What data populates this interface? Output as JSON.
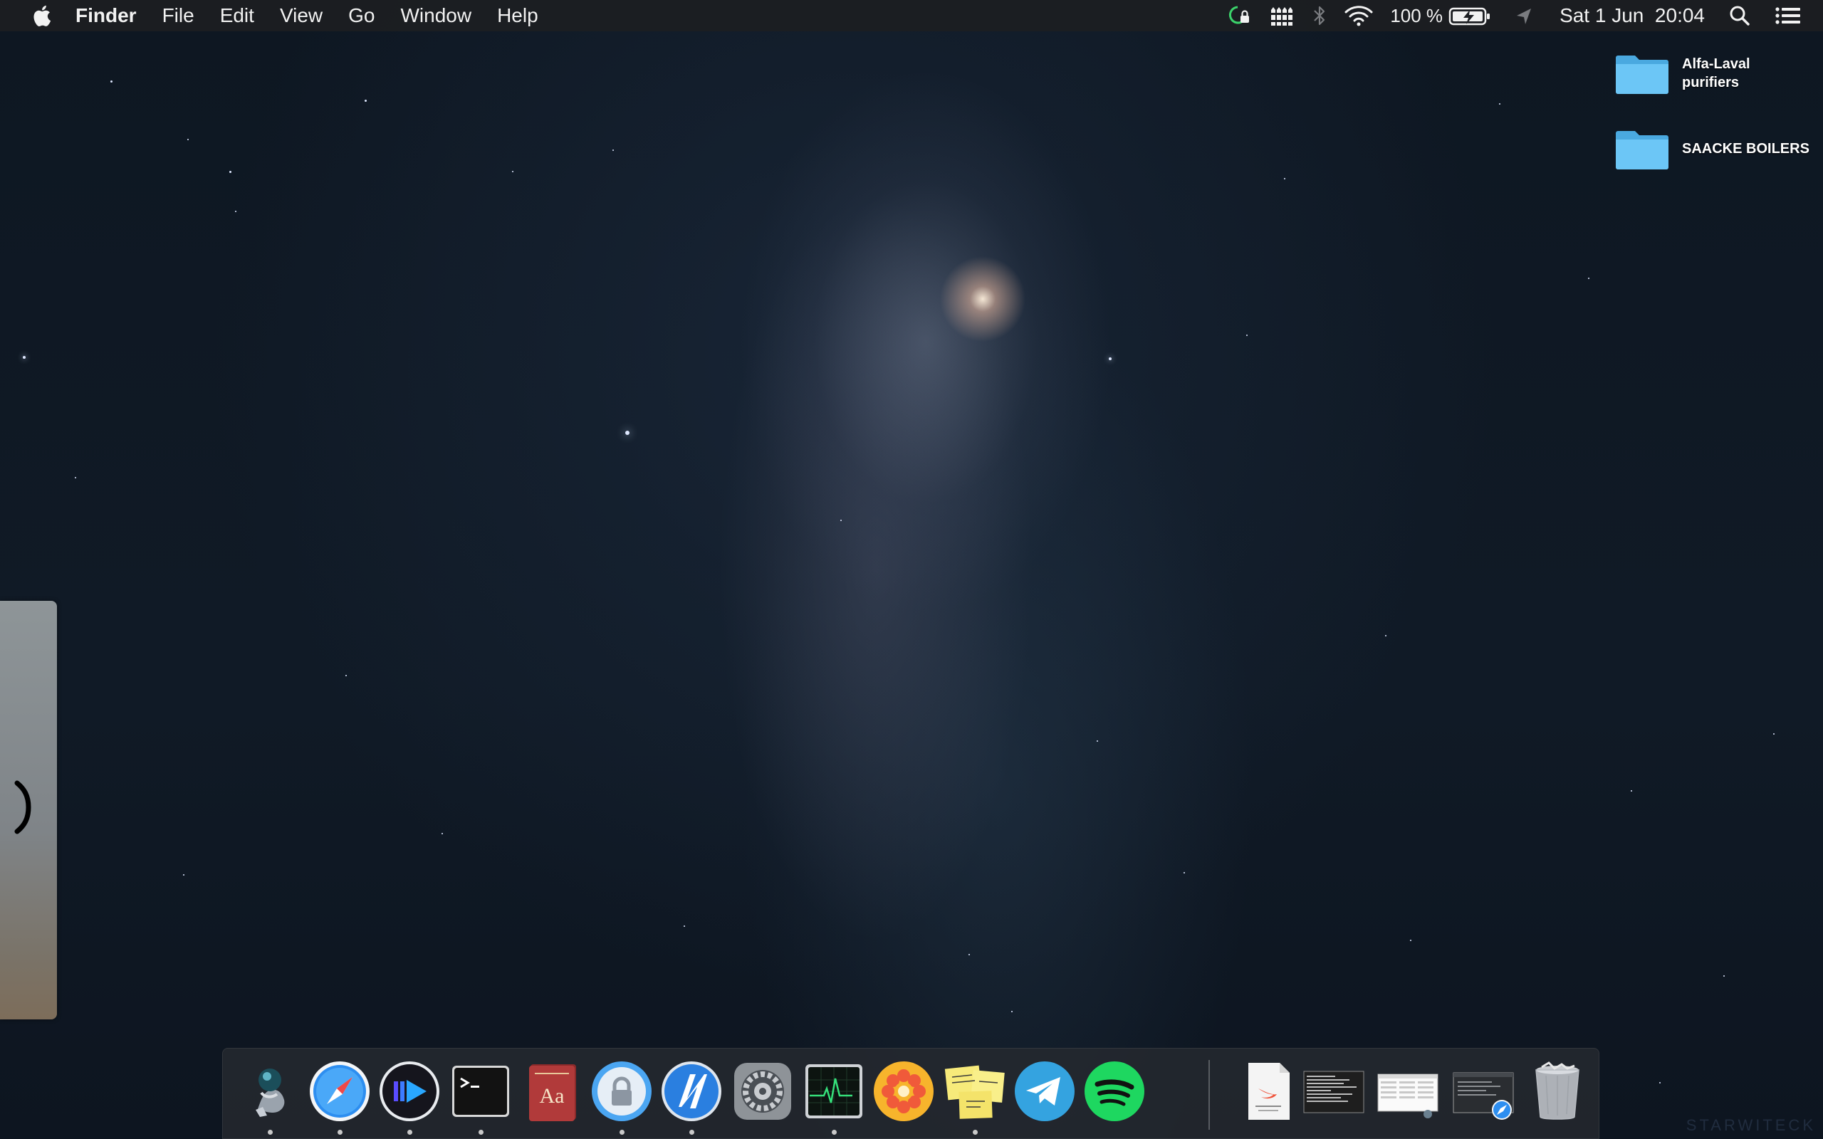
{
  "menubar": {
    "apple_icon": "apple-logo-icon",
    "app_name": "Finder",
    "menus": [
      "File",
      "Edit",
      "View",
      "Go",
      "Window",
      "Help"
    ],
    "status": {
      "battery_percent": "100 %",
      "datetime": "Sat 1 Jun  20:04"
    }
  },
  "desktop": {
    "folders": [
      {
        "label_line1": "Alfa-Laval",
        "label_line2": "purifiers"
      },
      {
        "label_line1": "SAACKE BOILERS",
        "label_line2": ""
      }
    ]
  },
  "wallpaper": {
    "watermark": "STARWITECK"
  },
  "dock": {
    "apps": [
      {
        "name": "Alfred",
        "icon": "alfred-icon",
        "running": true
      },
      {
        "name": "Safari",
        "icon": "safari-icon",
        "running": true
      },
      {
        "name": "Infuse",
        "icon": "infuse-icon",
        "running": true
      },
      {
        "name": "Terminal",
        "icon": "terminal-icon",
        "running": true
      },
      {
        "name": "Dictionary",
        "icon": "dictionary-icon",
        "running": false
      },
      {
        "name": "Keychain Access",
        "icon": "keychain-icon",
        "running": true
      },
      {
        "name": "Nautilus",
        "icon": "nautilus-icon",
        "running": true
      },
      {
        "name": "System Preferences",
        "icon": "system-preferences-icon",
        "running": false
      },
      {
        "name": "Activity Monitor",
        "icon": "activity-monitor-icon",
        "running": true
      },
      {
        "name": "Sunflower",
        "icon": "sunflower-icon",
        "running": false
      },
      {
        "name": "Stickies",
        "icon": "stickies-icon",
        "running": true
      },
      {
        "name": "Telegram",
        "icon": "telegram-icon",
        "running": false
      },
      {
        "name": "Spotify",
        "icon": "spotify-icon",
        "running": false
      }
    ],
    "documents": [
      {
        "name": "Swift document",
        "icon": "swift-document-icon"
      },
      {
        "name": "Terminal window",
        "icon": "terminal-window-thumbnail"
      },
      {
        "name": "Spreadsheet window",
        "icon": "spreadsheet-thumbnail"
      },
      {
        "name": "Safari window",
        "icon": "safari-window-thumbnail"
      },
      {
        "name": "Trash",
        "icon": "trash-icon"
      }
    ]
  },
  "colors": {
    "folder": "#5dbdf0",
    "menubar": "#1c1e22",
    "dock": "#262a30"
  }
}
